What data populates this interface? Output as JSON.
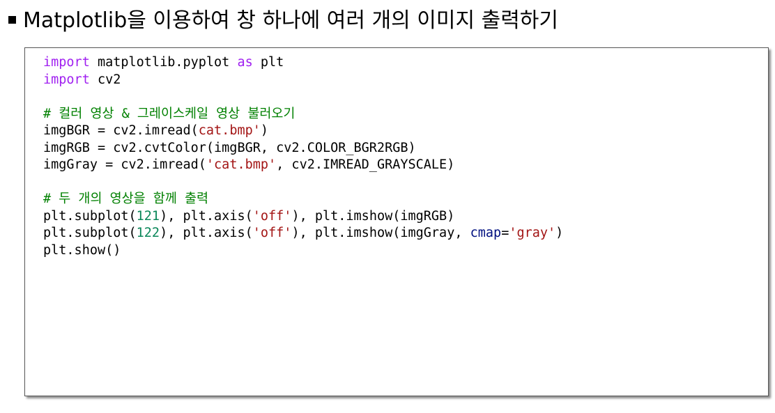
{
  "heading": {
    "text": "Matplotlib을 이용하여 창 하나에 여러 개의 이미지 출력하기"
  },
  "code": {
    "lines": [
      [
        {
          "t": "import",
          "c": "kw"
        },
        {
          "t": " matplotlib.pyplot ",
          "c": ""
        },
        {
          "t": "as",
          "c": "kw"
        },
        {
          "t": " plt",
          "c": ""
        }
      ],
      [
        {
          "t": "import",
          "c": "kw"
        },
        {
          "t": " cv2",
          "c": ""
        }
      ],
      [],
      [
        {
          "t": "# 컬러 영상 & 그레이스케일 영상 불러오기",
          "c": "cmt"
        }
      ],
      [
        {
          "t": "imgBGR = cv2.imread(",
          "c": ""
        },
        {
          "t": "cat.bmp'",
          "c": "str"
        },
        {
          "t": ")",
          "c": ""
        }
      ],
      [
        {
          "t": "imgRGB = cv2.cvtColor(imgBGR, cv2.COLOR_BGR2RGB)",
          "c": ""
        }
      ],
      [
        {
          "t": "imgGray = cv2.imread(",
          "c": ""
        },
        {
          "t": "'cat.bmp'",
          "c": "str"
        },
        {
          "t": ", cv2.IMREAD_GRAYSCALE)",
          "c": ""
        }
      ],
      [],
      [
        {
          "t": "# 두 개의 영상을 함께 출력",
          "c": "cmt"
        }
      ],
      [
        {
          "t": "plt.subplot(",
          "c": ""
        },
        {
          "t": "121",
          "c": "num"
        },
        {
          "t": "), plt.axis(",
          "c": ""
        },
        {
          "t": "'off'",
          "c": "str"
        },
        {
          "t": "), plt.imshow(imgRGB)",
          "c": ""
        }
      ],
      [
        {
          "t": "plt.subplot(",
          "c": ""
        },
        {
          "t": "122",
          "c": "num"
        },
        {
          "t": "), plt.axis(",
          "c": ""
        },
        {
          "t": "'off'",
          "c": "str"
        },
        {
          "t": "), plt.imshow(imgGray, ",
          "c": ""
        },
        {
          "t": "cmap",
          "c": "param"
        },
        {
          "t": "=",
          "c": ""
        },
        {
          "t": "'gray'",
          "c": "str"
        },
        {
          "t": ")",
          "c": ""
        }
      ],
      [
        {
          "t": "plt.show()",
          "c": ""
        }
      ]
    ]
  },
  "colors": {
    "keyword": "#a020f0",
    "string": "#a31515",
    "number": "#098658",
    "comment": "#008000",
    "parameter": "#001080"
  }
}
